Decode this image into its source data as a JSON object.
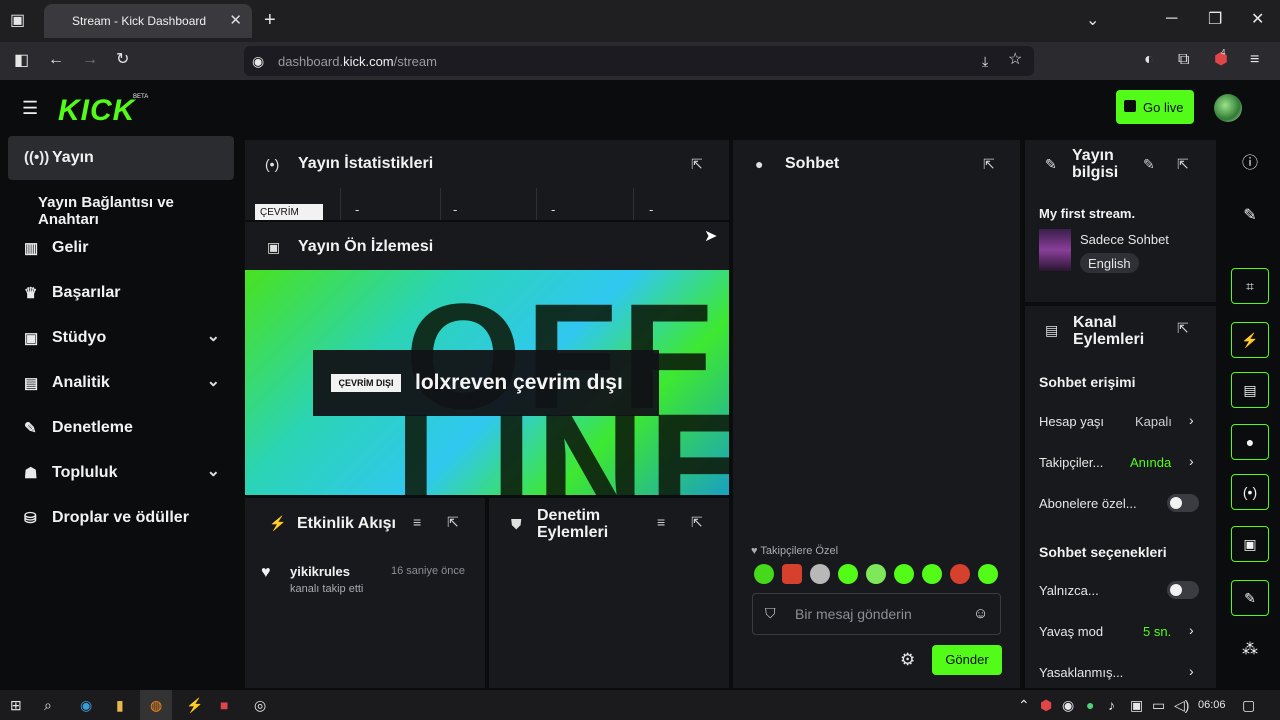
{
  "browser": {
    "tab_title": "Stream - Kick Dashboard",
    "url_prefix": "dashboard.",
    "url_domain": "kick.com",
    "url_path": "/stream",
    "ext_badge": "4"
  },
  "header": {
    "logo": "KICK",
    "beta": "BETA",
    "go_live": "Go live"
  },
  "sidebar": {
    "items": [
      {
        "label": "Yayın",
        "icon": "broadcast-icon"
      },
      {
        "label": "Yayın Bağlantısı ve Anahtarı"
      },
      {
        "label": "Gelir",
        "icon": "chart-icon"
      },
      {
        "label": "Başarılar",
        "icon": "trophy-icon"
      },
      {
        "label": "Stüdyo",
        "icon": "studio-icon"
      },
      {
        "label": "Analitik",
        "icon": "analytics-icon"
      },
      {
        "label": "Denetleme",
        "icon": "wrench-icon"
      },
      {
        "label": "Topluluk",
        "icon": "community-icon"
      },
      {
        "label": "Droplar ve ödüller",
        "icon": "drops-icon"
      }
    ]
  },
  "stats": {
    "title": "Yayın İstatistikleri",
    "badge": "ÇEVRİM",
    "values": [
      "-",
      "-",
      "-",
      "-"
    ]
  },
  "preview": {
    "title": "Yayın Ön İzlemesi",
    "bg_text_1": "OFF",
    "bg_text_2": "LINE",
    "offline_badge": "ÇEVRİM DIŞI",
    "offline_text": "lolxreven çevrim dışı"
  },
  "activity": {
    "title": "Etkinlik Akışı",
    "items": [
      {
        "user": "yikikrules",
        "time": "16 saniye önce",
        "action": "kanalı takip etti"
      }
    ]
  },
  "moderation": {
    "title_line1": "Denetim",
    "title_line2": "Eylemleri"
  },
  "chat": {
    "title": "Sohbet",
    "followers_only": "Takipçilere Özel",
    "placeholder": "Bir mesaj gönderin",
    "send": "Gönder"
  },
  "stream_info": {
    "title_line1": "Yayın",
    "title_line2": "bilgisi",
    "stream_title": "My first stream.",
    "category": "Sadece Sohbet",
    "language": "English"
  },
  "channel_actions": {
    "title_line1": "Kanal",
    "title_line2": "Eylemleri",
    "chat_access": "Sohbet erişimi",
    "account_age": {
      "label": "Hesap yaşı",
      "value": "Kapalı"
    },
    "followers": {
      "label": "Takipçiler...",
      "value": "Anında"
    },
    "subs_only": {
      "label": "Abonelere özel..."
    },
    "chat_options": "Sohbet seçenekleri",
    "only": {
      "label": "Yalnızca..."
    },
    "slow_mode": {
      "label": "Yavaş mod",
      "value": "5 sn."
    },
    "banned": {
      "label": "Yasaklanmış..."
    }
  },
  "taskbar": {
    "time": "06:06"
  },
  "colors": {
    "accent": "#53fc18",
    "panel": "#18191d",
    "background": "#0b0c0e"
  }
}
